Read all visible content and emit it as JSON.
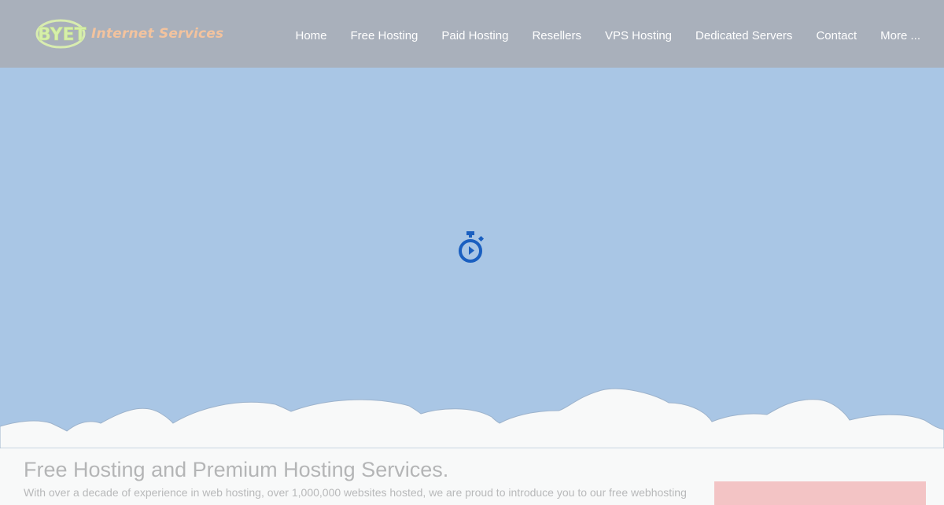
{
  "header": {
    "logo_mark": "BYET",
    "logo_text": "Internet Services",
    "nav": [
      {
        "label": "Home"
      },
      {
        "label": "Free Hosting"
      },
      {
        "label": "Paid Hosting"
      },
      {
        "label": "Resellers"
      },
      {
        "label": "VPS Hosting"
      },
      {
        "label": "Dedicated Servers"
      },
      {
        "label": "Contact"
      },
      {
        "label": "More ..."
      }
    ]
  },
  "hero": {
    "loader_icon": "stopwatch-icon",
    "background_color": "#a9c6e5",
    "loader_color": "#1a5fc0"
  },
  "main": {
    "headline": "Free Hosting and Premium Hosting Services.",
    "intro": "With over a decade of experience in web hosting, over 1,000,000 websites hosted, we are proud to introduce you to our free webhosting"
  },
  "colors": {
    "navbar": "#a9b0bb",
    "page_background": "#f8f9f9",
    "side_box": "#f3c4c5"
  }
}
